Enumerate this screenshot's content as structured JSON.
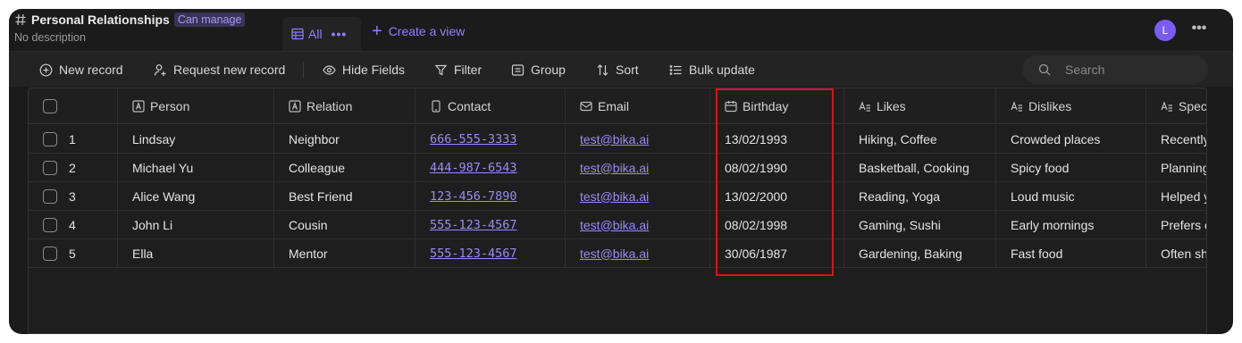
{
  "header": {
    "title": "Personal Relationships",
    "permission_badge": "Can manage",
    "description": "No description",
    "view_tab_label": "All",
    "view_tab_more": "•••",
    "create_view_label": "Create a view",
    "avatar_initial": "L",
    "more_label": "•••"
  },
  "toolbar": {
    "new_record": "New record",
    "request_new_record": "Request new record",
    "hide_fields": "Hide Fields",
    "filter": "Filter",
    "group": "Group",
    "sort": "Sort",
    "bulk_update": "Bulk update",
    "search_placeholder": "Search"
  },
  "columns": [
    {
      "label": "Person",
      "icon": "text-field-icon"
    },
    {
      "label": "Relation",
      "icon": "text-field-icon"
    },
    {
      "label": "Contact",
      "icon": "phone-icon"
    },
    {
      "label": "Email",
      "icon": "email-icon"
    },
    {
      "label": "Birthday",
      "icon": "calendar-icon"
    },
    {
      "label": "Likes",
      "icon": "long-text-icon"
    },
    {
      "label": "Dislikes",
      "icon": "long-text-icon"
    },
    {
      "label": "Speci",
      "icon": "long-text-icon"
    }
  ],
  "rows": [
    {
      "num": "1",
      "person": "Lindsay",
      "relation": "Neighbor",
      "contact": "666-555-3333",
      "email": "test@bika.ai",
      "birthday": "13/02/1993",
      "likes": "Hiking, Coffee",
      "dislikes": "Crowded places",
      "special": "Recently"
    },
    {
      "num": "2",
      "person": "Michael Yu",
      "relation": "Colleague",
      "contact": "444-987-6543",
      "email": "test@bika.ai",
      "birthday": "08/02/1990",
      "likes": "Basketball, Cooking",
      "dislikes": "Spicy food",
      "special": "Planning"
    },
    {
      "num": "3",
      "person": "Alice Wang",
      "relation": "Best Friend",
      "contact": "123-456-7890",
      "email": "test@bika.ai",
      "birthday": "13/02/2000",
      "likes": "Reading, Yoga",
      "dislikes": "Loud music",
      "special": "Helped y"
    },
    {
      "num": "4",
      "person": "John Li",
      "relation": "Cousin",
      "contact": "555-123-4567",
      "email": "test@bika.ai",
      "birthday": "08/02/1998",
      "likes": "Gaming, Sushi",
      "dislikes": "Early mornings",
      "special": "Prefers c"
    },
    {
      "num": "5",
      "person": "Ella",
      "relation": "Mentor",
      "contact": "555-123-4567",
      "email": "test@bika.ai",
      "birthday": "30/06/1987",
      "likes": "Gardening, Baking",
      "dislikes": "Fast food",
      "special": "Often sh"
    }
  ],
  "colors": {
    "accent": "#8f80ff",
    "highlight_border": "#e01010",
    "background": "#1b1b1b"
  }
}
